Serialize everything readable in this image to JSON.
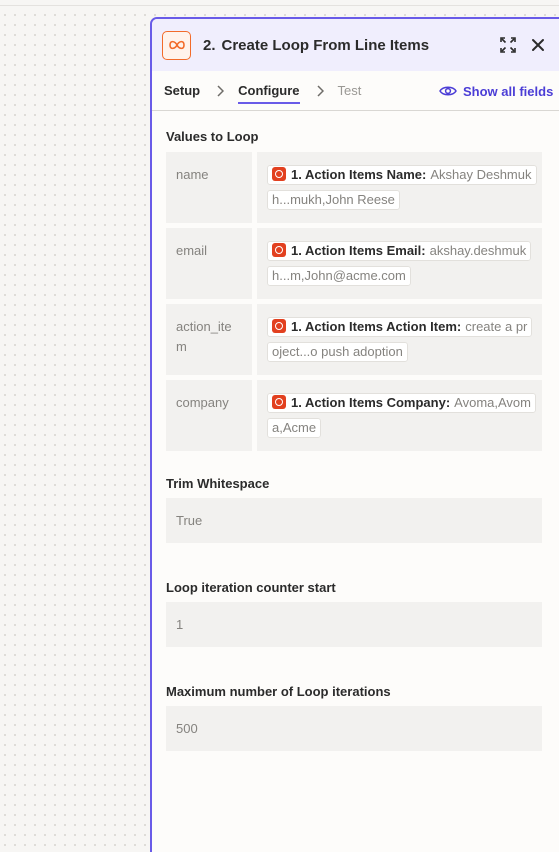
{
  "step": {
    "number": "2.",
    "title": "Create Loop From Line Items"
  },
  "tabs": [
    {
      "label": "Setup",
      "state": "done"
    },
    {
      "label": "Configure",
      "state": "active"
    },
    {
      "label": "Test",
      "state": "disabled"
    }
  ],
  "show_all_fields": "Show all fields",
  "values_to_loop": {
    "label": "Values to Loop",
    "rows": [
      {
        "key": "name",
        "source": "1. Action Items Name:",
        "value": "Akshay Deshmukh...mukh,John Reese"
      },
      {
        "key": "email",
        "source": "1. Action Items Email:",
        "value": "akshay.deshmukh...m,John@acme.com"
      },
      {
        "key": "action_item",
        "source": "1. Action Items Action Item:",
        "value": "create a project...o push adoption"
      },
      {
        "key": "company",
        "source": "1. Action Items Company:",
        "value": "Avoma,Avoma,Acme"
      }
    ]
  },
  "fields": [
    {
      "label": "Trim Whitespace",
      "value": "True"
    },
    {
      "label": "Loop iteration counter start",
      "value": "1"
    },
    {
      "label": "Maximum number of Loop iterations",
      "value": "500"
    }
  ],
  "colors": {
    "accent": "#695be8",
    "link": "#4b3dd6",
    "app_orange": "#f26b2a",
    "source_icon_red": "#e2401f"
  },
  "icons": {
    "app": "loop-icon",
    "expand": "expand-icon",
    "close": "close-icon",
    "show_fields": "eye-icon",
    "source": "action-items-app-icon"
  }
}
